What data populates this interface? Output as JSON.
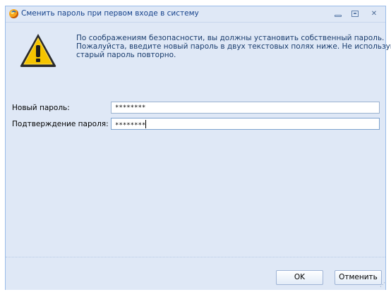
{
  "window": {
    "title": "Сменить пароль при первом входе в систему",
    "controls": [
      "minimize",
      "maximize",
      "close"
    ],
    "close_glyph": "✕"
  },
  "message": {
    "icon": "warning-icon",
    "lines": [
      "По соображениям безопасности, вы должны установить собственный пароль.",
      "Пожалуйста, введите новый пароль в двух текстовых полях ниже. Не используйте",
      "старый пароль повторно."
    ]
  },
  "form": {
    "new_password_label": "Новый пароль:",
    "new_password_value": "********",
    "confirm_password_label": "Подтверждение пароля:",
    "confirm_password_value": "********"
  },
  "buttons": {
    "ok": "OK",
    "cancel": "Отменить"
  },
  "colors": {
    "window_bg": "#dfe8f6",
    "title_text": "#15428b",
    "warning_fill": "#f5c400"
  }
}
